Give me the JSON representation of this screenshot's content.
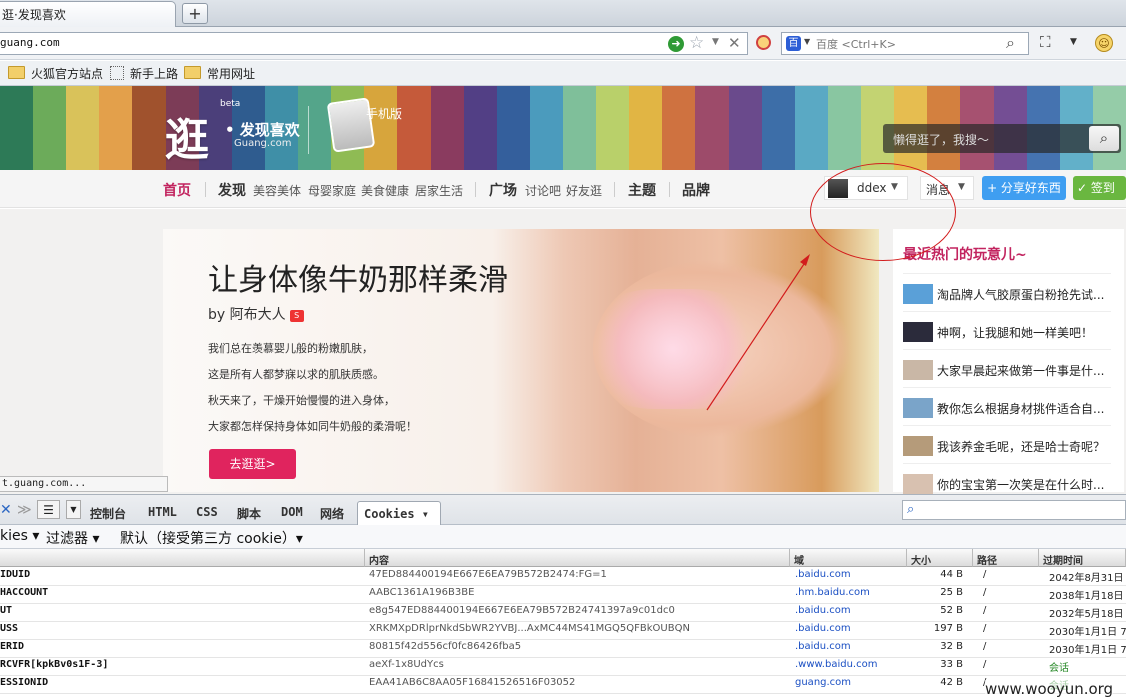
{
  "browser": {
    "tab_title": "逛·发现喜欢",
    "new_tab": "+",
    "url": "guang.com",
    "search_placeholder": "百度 <Ctrl+K>",
    "bookmarks": [
      {
        "label": "火狐官方站点"
      },
      {
        "label": "新手上路"
      },
      {
        "label": "常用网址"
      }
    ],
    "status_text": "t.guang.com..."
  },
  "site": {
    "logo_char": "逛",
    "logo_beta": "beta",
    "logo_slogan": "• 发现喜欢",
    "logo_domain": "Guang.com",
    "mobile_label": "手机版",
    "search_placeholder": "懒得逛了，我搜～",
    "search_icon": "magnifier-icon",
    "nav": {
      "home": "首页",
      "discover": "发现",
      "discover_subs": [
        "美容美体",
        "母婴家庭",
        "美食健康",
        "居家生活"
      ],
      "plaza": "广场",
      "plaza_subs": [
        "讨论吧",
        "好友逛"
      ],
      "topics": "主题",
      "brands": "品牌",
      "username": "ddex",
      "messages": "消息",
      "share": "+ 分享好东西",
      "checkin": "签到"
    },
    "feature": {
      "title": "让身体像牛奶那样柔滑",
      "author": "by 阿布大人",
      "badge": "S",
      "lines": [
        "我们总在羡慕婴儿般的粉嫩肌肤，",
        "这是所有人都梦寐以求的肌肤质感。",
        "秋天来了，干燥开始慢慢的进入身体，",
        "大家都怎样保持身体如同牛奶般的柔滑呢！"
      ],
      "button": "去逛逛>"
    },
    "hot": {
      "title": "最近热门的玩意儿~",
      "items": [
        {
          "text": "淘品牌人气胶原蛋白粉抢先试...",
          "thumb_color": "#5aa0d8"
        },
        {
          "text": "神啊，让我腿和她一样美吧！",
          "thumb_color": "#2b2b3b"
        },
        {
          "text": "大家早晨起来做第一件事是什...",
          "thumb_color": "#c9b7a6"
        },
        {
          "text": "教你怎么根据身材挑件适合自...",
          "thumb_color": "#7aa4c9"
        },
        {
          "text": "我该养金毛呢，还是哈士奇呢？",
          "thumb_color": "#b59b7a"
        },
        {
          "text": "你的宝宝第一次笑是在什么时...",
          "thumb_color": "#d8c1b0"
        }
      ]
    }
  },
  "firebug": {
    "tabs": [
      "控制台",
      "HTML",
      "CSS",
      "脚本",
      "DOM",
      "网络"
    ],
    "active_tab": "Cookies ▾",
    "sub_cookies": "kies ▾",
    "sub_filter": "过滤器 ▾",
    "sub_default": "默认（接受第三方 cookie）▾",
    "columns": {
      "value": "内容",
      "domain": "域",
      "size": "大小",
      "path": "路径",
      "expires": "过期时间"
    },
    "rows": [
      {
        "name": "IDUID",
        "value": "47ED884400194E667E6EA79B572B2474:FG=1",
        "domain": ".baidu.com",
        "size": "44 B",
        "path": "/",
        "expires": "2042年8月31日"
      },
      {
        "name": "HACCOUNT",
        "value": "AABC1361A196B3BE",
        "domain": ".hm.baidu.com",
        "size": "25 B",
        "path": "/",
        "expires": "2038年1月18日"
      },
      {
        "name": "UT",
        "value": "e8g547ED884400194E667E6EA79B572B24741397a9c01dc0",
        "domain": ".baidu.com",
        "size": "52 B",
        "path": "/",
        "expires": "2032年5月18日"
      },
      {
        "name": "USS",
        "value": "XRKMXpDRlprNkdSbWR2YVBJ...AxMC44MS41MGQ5QFBkOUBQN",
        "domain": ".baidu.com",
        "size": "197 B",
        "path": "/",
        "expires": "2030年1月1日 7"
      },
      {
        "name": "ERID",
        "value": "80815f42d556cf0fc86426fba5",
        "domain": ".baidu.com",
        "size": "32 B",
        "path": "/",
        "expires": "2030年1月1日 7"
      },
      {
        "name": "RCVFR[kpkBv0s1F-3]",
        "value": "aeXf-1x8UdYcs",
        "domain": ".www.baidu.com",
        "size": "33 B",
        "path": "/",
        "expires": "会话"
      },
      {
        "name": "ESSIONID",
        "value": "EAA41AB6C8AA05F16841526516F03052",
        "domain": "guang.com",
        "size": "42 B",
        "path": "/",
        "expires": "会话"
      }
    ]
  },
  "watermark": "www.wooyun.org",
  "colors": {
    "accent": "#c2245f",
    "share": "#3f9ef1",
    "checkin": "#6ab740",
    "annotation": "#d21c1c"
  }
}
